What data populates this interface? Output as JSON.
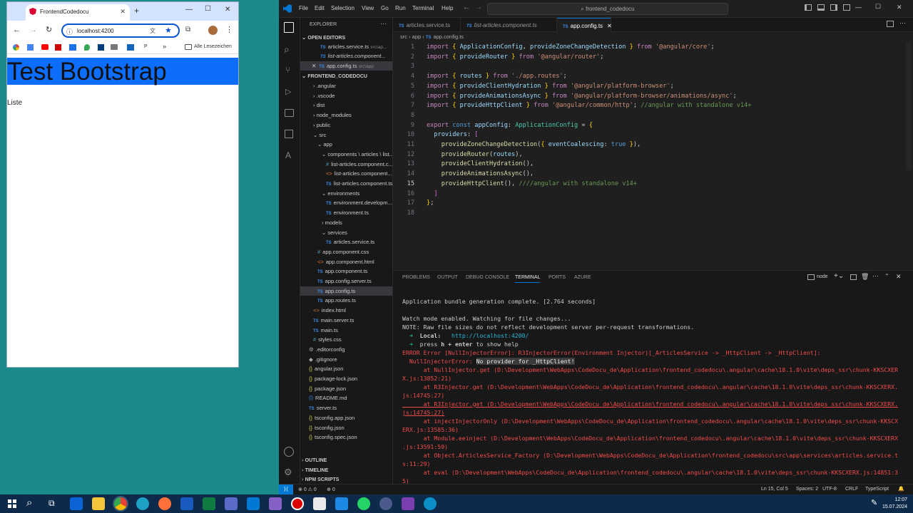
{
  "browser": {
    "tab_title": "FrontendCodedocu",
    "url": "localhost:4200",
    "bookmarks_folder": "Alle Lesezeichen",
    "bookmark_p": "P",
    "page": {
      "heading": "Test Bootstrap",
      "text": "Liste"
    }
  },
  "vscode": {
    "menu": [
      "File",
      "Edit",
      "Selection",
      "View",
      "Go",
      "Run",
      "Terminal",
      "Help"
    ],
    "search": "frontend_codedocu",
    "explorer_title": "EXPLORER",
    "open_editors_title": "OPEN EDITORS",
    "open_editors": [
      {
        "name": "articles.service.ts",
        "path": "src\\ap..."
      },
      {
        "name": "list-articles.component...",
        "path": ""
      },
      {
        "name": "app.config.ts",
        "path": "src\\app"
      }
    ],
    "project_title": "FRONTEND_CODEDOCU",
    "tree": [
      {
        "label": ".angular",
        "kind": "folder"
      },
      {
        "label": ".vscode",
        "kind": "folder"
      },
      {
        "label": "dist",
        "kind": "folder"
      },
      {
        "label": "node_modules",
        "kind": "folder"
      },
      {
        "label": "public",
        "kind": "folder"
      },
      {
        "label": "src",
        "kind": "folder-open"
      },
      {
        "label": "app",
        "kind": "folder-open"
      },
      {
        "label": "components \\ articles \\ list...",
        "kind": "folder-open"
      },
      {
        "label": "list-articles.component.c...",
        "kind": "css"
      },
      {
        "label": "list-articles.component....",
        "kind": "html"
      },
      {
        "label": "list-articles.component.ts",
        "kind": "ts"
      },
      {
        "label": "environments",
        "kind": "folder-open"
      },
      {
        "label": "environment.developm...",
        "kind": "ts"
      },
      {
        "label": "environment.ts",
        "kind": "ts"
      },
      {
        "label": "models",
        "kind": "folder"
      },
      {
        "label": "services",
        "kind": "folder-open"
      },
      {
        "label": "articles.service.ts",
        "kind": "ts"
      },
      {
        "label": "app.component.css",
        "kind": "css"
      },
      {
        "label": "app.component.html",
        "kind": "html"
      },
      {
        "label": "app.component.ts",
        "kind": "ts"
      },
      {
        "label": "app.config.server.ts",
        "kind": "ts"
      },
      {
        "label": "app.config.ts",
        "kind": "ts"
      },
      {
        "label": "app.routes.ts",
        "kind": "ts"
      },
      {
        "label": "index.html",
        "kind": "html"
      },
      {
        "label": "main.server.ts",
        "kind": "ts"
      },
      {
        "label": "main.ts",
        "kind": "ts"
      },
      {
        "label": "styles.css",
        "kind": "css"
      },
      {
        "label": ".editorconfig",
        "kind": "gear"
      },
      {
        "label": ".gitignore",
        "kind": "git"
      },
      {
        "label": "angular.json",
        "kind": "json"
      },
      {
        "label": "package-lock.json",
        "kind": "json"
      },
      {
        "label": "package.json",
        "kind": "json"
      },
      {
        "label": "README.md",
        "kind": "md"
      },
      {
        "label": "server.ts",
        "kind": "ts"
      },
      {
        "label": "tsconfig.app.json",
        "kind": "json"
      },
      {
        "label": "tsconfig.json",
        "kind": "json"
      },
      {
        "label": "tsconfig.spec.json",
        "kind": "json"
      }
    ],
    "outline": "OUTLINE",
    "timeline": "TIMELINE",
    "npm_scripts": "NPM SCRIPTS",
    "editor_tabs": [
      {
        "label": "articles.service.ts",
        "active": false
      },
      {
        "label": "list-articles.component.ts",
        "active": false
      },
      {
        "label": "app.config.ts",
        "active": true
      }
    ],
    "breadcrumb": [
      "src",
      "app",
      "app.config.ts"
    ],
    "panel_tabs": [
      "PROBLEMS",
      "OUTPUT",
      "DEBUG CONSOLE",
      "TERMINAL",
      "PORTS",
      "AZURE"
    ],
    "terminal_name": "node",
    "terminal": {
      "l1": "Application bundle generation complete. [2.764 seconds]",
      "l2": "Watch mode enabled. Watching for file changes...",
      "l3": "NOTE: Raw file sizes do not reflect development server per-request transformations.",
      "local_label": "Local:",
      "local_url": "http://localhost:4200/",
      "help_pre": "press ",
      "help_key": "h + enter",
      "help_post": " to show help",
      "err1": "ERROR Error [NullInjectorError]: R3InjectorError(Environment Injector)[_ArticlesService -> _HttpClient -> _HttpClient]:",
      "err2a": "  NullInjectorError: ",
      "err2b": "No provider for _HttpClient!",
      "err3": "      at NullInjector.get (D:\\Development\\WebApps\\CodeDocu_de\\Application\\frontend_codedocu\\.angular\\cache\\18.1.0\\vite\\deps_ssr\\chunk-KKSCXER",
      "err4": "X.js:13852:21)",
      "err5": "      at R3Injector.get (D:\\Development\\WebApps\\CodeDocu_de\\Application\\frontend_codedocu\\.angular\\cache\\18.1.0\\vite\\deps_ssr\\chunk-KKSCXERX.",
      "err6": "js:14745:27)",
      "err7": "      at R3Injector.get (D:\\Development\\WebApps\\CodeDocu_de\\Application\\frontend_codedocu\\.angular\\cache\\18.1.0\\vite\\deps_ssr\\chunk-KKSCXERX.",
      "err8": "js:14745:27)",
      "err9": "      at injectInjectorOnly (D:\\Development\\WebApps\\CodeDocu_de\\Application\\frontend_codedocu\\.angular\\cache\\18.1.0\\vite\\deps_ssr\\chunk-KKSCX",
      "err10": "ERX.js:13585:36)",
      "err11": "      at Module.eeinject (D:\\Development\\WebApps\\CodeDocu_de\\Application\\frontend_codedocu\\.angular\\cache\\18.1.0\\vite\\deps_ssr\\chunk-KKSCXERX",
      "err12": ".js:13591:59)",
      "err13": "      at Object.ArticlesService_Factory (D:\\Development\\WebApps\\CodeDocu_de\\Application\\frontend_codedocu\\src\\app\\services\\articles.service.t",
      "err14": "s:11:29)",
      "err15": "      at eval (D:\\Development\\WebApps\\CodeDocu_de\\Application\\frontend_codedocu\\.angular\\cache\\18.1.0\\vite\\deps_ssr\\chunk-KKSCXERX.js:14851:3",
      "err16": "5)"
    },
    "status": {
      "errors": "0",
      "warnings": "0",
      "ports": "0",
      "position": "Ln 15, Col 5",
      "spaces": "Spaces: 2",
      "encoding": "UTF-8",
      "eol": "CRLF",
      "language": "TypeScript"
    }
  },
  "taskbar": {
    "time": "12:07",
    "date": "15.07.2024"
  }
}
